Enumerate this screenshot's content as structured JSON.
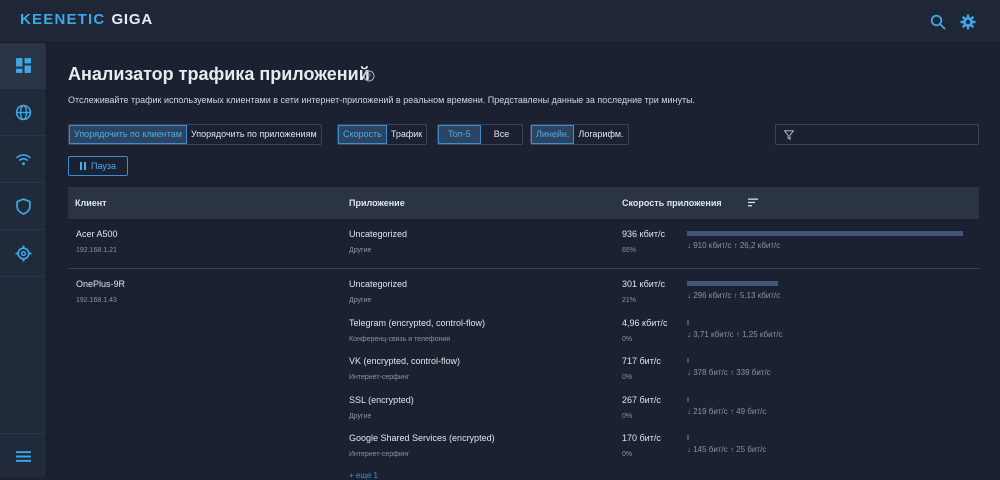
{
  "brand": {
    "part1": "KEENETIC",
    "part2": "GIGA"
  },
  "header_icons": [
    "search-icon",
    "gear-icon"
  ],
  "sidebar": {
    "items": [
      {
        "name": "dashboard-icon",
        "active": true
      },
      {
        "name": "globe-icon",
        "active": false
      },
      {
        "name": "wifi-icon",
        "active": false
      },
      {
        "name": "shield-icon",
        "active": false
      },
      {
        "name": "settings-icon",
        "active": false
      }
    ],
    "bottom": "menu-icon"
  },
  "page": {
    "title": "Анализатор трафика приложений",
    "subtitle": "Отслеживайте трафик используемых клиентами в сети интернет-приложений в реальном времени. Представлены данные за последние три минуты."
  },
  "controls": {
    "sort": {
      "opt1": "Упорядочить по клиентам",
      "opt2": "Упорядочить по приложениям",
      "selected": 0
    },
    "metric": {
      "opt1": "Скорость",
      "opt2": "Трафик",
      "selected": 0
    },
    "limit": {
      "opt1": "Топ-5",
      "opt2": "Все",
      "selected": 0
    },
    "scale": {
      "opt1": "Линейн.",
      "opt2": "Логарифм.",
      "selected": 0
    },
    "filter_placeholder": "",
    "pause_label": "Пауза"
  },
  "table": {
    "headers": {
      "client": "Клиент",
      "app": "Приложение",
      "speed": "Скорость приложения"
    },
    "clients": [
      {
        "name": "Acer A500",
        "ip": "192.168.1.21",
        "apps": [
          {
            "name": "Uncategorized",
            "category": "Другие",
            "speed": "936 кбит/с",
            "pct": "65%",
            "share": 0.97,
            "down": "910 кбит/с",
            "up": "26,2 кбит/с"
          }
        ]
      },
      {
        "name": "OnePlus-9R",
        "ip": "192.168.1.43",
        "apps": [
          {
            "name": "Uncategorized",
            "category": "Другие",
            "speed": "301 кбит/с",
            "pct": "21%",
            "share": 0.32,
            "down": "296 кбит/с",
            "up": "5,13 кбит/с"
          },
          {
            "name": "Telegram (encrypted, control-flow)",
            "category": "Конференц-связь и телефония",
            "speed": "4,96 кбит/с",
            "pct": "0%",
            "share": 0.005,
            "down": "3,71 кбит/с",
            "up": "1,25 кбит/с"
          },
          {
            "name": "VK (encrypted, control-flow)",
            "category": "Интернет-серфинг",
            "speed": "717 бит/с",
            "pct": "0%",
            "share": 0.003,
            "down": "378 бит/с",
            "up": "339 бит/с"
          },
          {
            "name": "SSL (encrypted)",
            "category": "Другие",
            "speed": "267 бит/с",
            "pct": "0%",
            "share": 0.003,
            "down": "219 бит/с",
            "up": "49 бит/с"
          },
          {
            "name": "Google Shared Services (encrypted)",
            "category": "Интернет-серфинг",
            "speed": "170 бит/с",
            "pct": "0%",
            "share": 0.003,
            "down": "145 бит/с",
            "up": "25 бит/с"
          }
        ],
        "more": "+ еще 1"
      }
    ]
  },
  "colors": {
    "accent": "#3b8fd0",
    "bar": "#44557a",
    "bg": "#1b2130"
  }
}
